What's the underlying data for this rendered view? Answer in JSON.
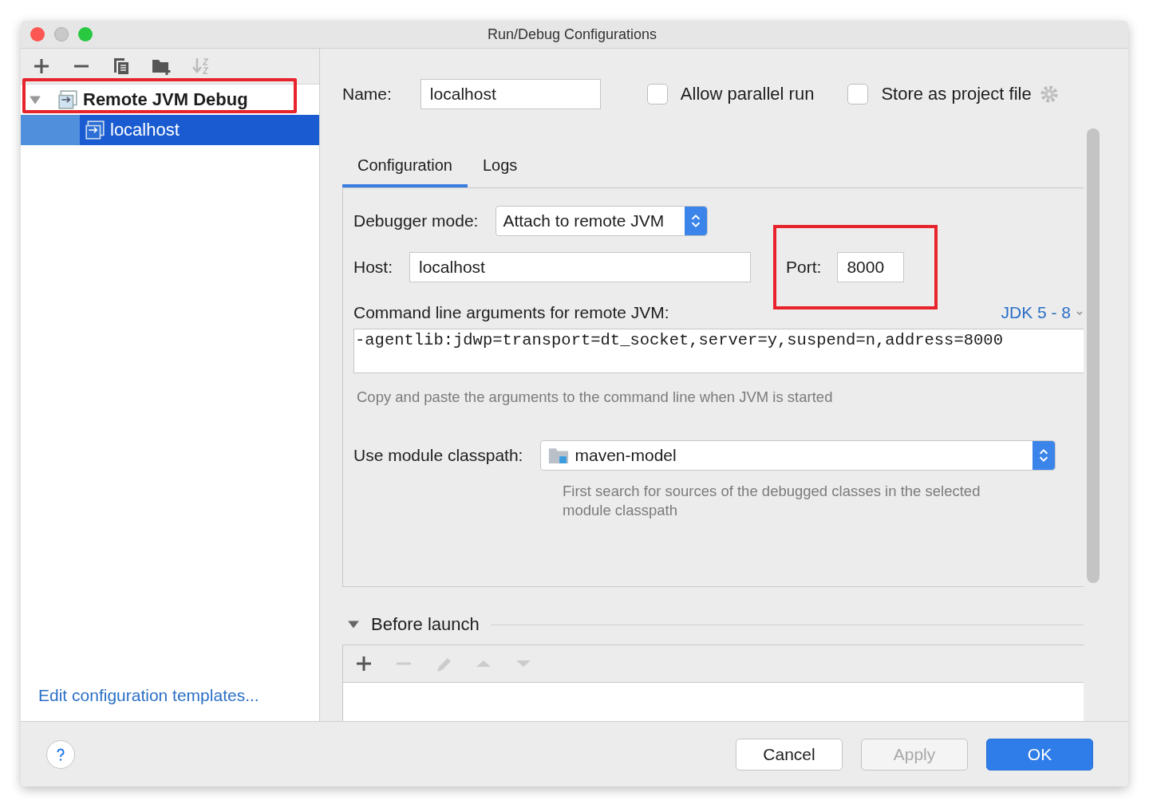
{
  "window": {
    "title": "Run/Debug Configurations"
  },
  "sidebar": {
    "tree": [
      {
        "label": "Remote JVM Debug",
        "expanded": true,
        "selected": false,
        "highlighted": true,
        "children": [
          {
            "label": "localhost",
            "selected": true,
            "highlighted": false
          }
        ]
      }
    ],
    "footer_link": "Edit configuration templates..."
  },
  "form": {
    "name": {
      "label": "Name:",
      "value": "localhost"
    },
    "checkboxes": [
      {
        "label": "Allow parallel run",
        "checked": false
      },
      {
        "label": "Store as project file",
        "checked": false
      }
    ],
    "tabs": [
      {
        "label": "Configuration",
        "selected": true
      },
      {
        "label": "Logs",
        "selected": false
      }
    ],
    "debugger_mode": {
      "label": "Debugger mode:",
      "value": "Attach to remote JVM"
    },
    "host": {
      "label": "Host:",
      "value": "localhost"
    },
    "port": {
      "label": "Port:",
      "value": "8000",
      "highlighted": true
    },
    "command_line": {
      "label": "Command line arguments for remote JVM:",
      "jdk_link": "JDK 5 - 8",
      "value": "-agentlib:jdwp=transport=dt_socket,server=y,suspend=n,address=8000",
      "hint": "Copy and paste the arguments to the command line when JVM is started"
    },
    "module_classpath": {
      "label": "Use module classpath:",
      "value": "maven-model",
      "hint": "First search for sources of the debugged classes in the selected module classpath"
    },
    "before_launch": {
      "label": "Before launch",
      "expanded": true
    }
  },
  "buttons": [
    {
      "label": "Cancel",
      "kind": "default"
    },
    {
      "label": "Apply",
      "kind": "disabled"
    },
    {
      "label": "OK",
      "kind": "primary"
    }
  ]
}
